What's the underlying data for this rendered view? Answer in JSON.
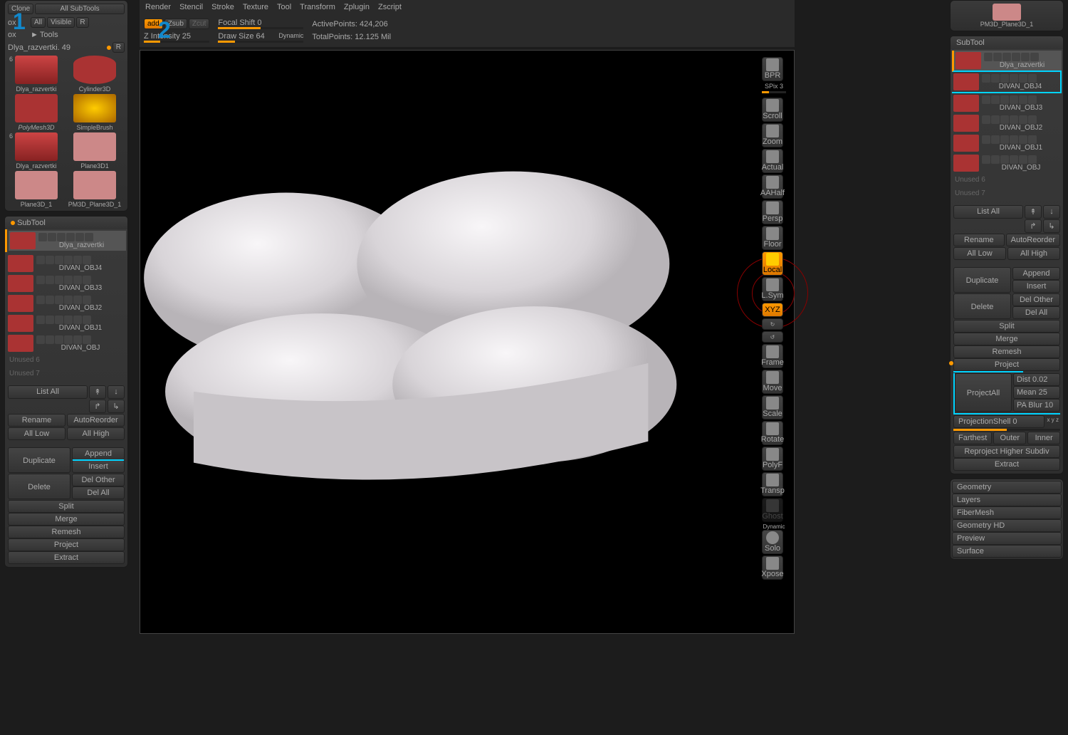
{
  "left": {
    "clone": "Clone",
    "makePoly": "All SubTools",
    "boxAll": "All",
    "visible": "Visible",
    "r": "R",
    "tools": "Tools",
    "toolName": "Dlya_razvertki. 49",
    "items": [
      {
        "label": "Dlya_razvertki",
        "count": "6"
      },
      {
        "label": "Cylinder3D"
      },
      {
        "label": "PolyMesh3D"
      },
      {
        "label": "SimpleBrush"
      },
      {
        "label": "Dlya_razvertki",
        "count": "6"
      },
      {
        "label": "Plane3D1"
      },
      {
        "label": "Plane3D_1"
      },
      {
        "label": "PM3D_Plane3D_1"
      }
    ]
  },
  "subtool": {
    "header": "SubTool",
    "items": [
      {
        "name": "Dlya_razvertki",
        "active": true
      },
      {
        "name": "DIVAN_OBJ4"
      },
      {
        "name": "DIVAN_OBJ3"
      },
      {
        "name": "DIVAN_OBJ2"
      },
      {
        "name": "DIVAN_OBJ1"
      },
      {
        "name": "DIVAN_OBJ"
      }
    ],
    "unused6": "Unused  6",
    "unused7": "Unused  7",
    "listAll": "List All",
    "rename": "Rename",
    "autoReorder": "AutoReorder",
    "allLow": "All Low",
    "allHigh": "All High",
    "duplicate": "Duplicate",
    "append": "Append",
    "insert": "Insert",
    "delete": "Delete",
    "delOther": "Del Other",
    "delAll": "Del All",
    "split": "Split",
    "merge": "Merge",
    "remesh": "Remesh",
    "project": "Project",
    "extract": "Extract",
    "projectAll": "ProjectAll",
    "dist": "Dist 0.02",
    "mean": "Mean 25",
    "paBlur": "PA Blur 10",
    "projectionShell": "ProjectionShell 0",
    "xyz": "x y z",
    "farthest": "Farthest",
    "outer": "Outer",
    "inner": "Inner",
    "reproject": "Reproject Higher Subdiv"
  },
  "menu": {
    "items": [
      "Render",
      "Stencil",
      "Stroke",
      "Texture",
      "Tool",
      "Transform",
      "Zplugin",
      "Zscript"
    ]
  },
  "topbar": {
    "zadd": "add",
    "zsub": "Zsub",
    "zcut": "Zcut",
    "zIntensity": "Z Intensity 25",
    "focalShift": "Focal Shift 0",
    "drawSize": "Draw Size 64",
    "dynamic": "Dynamic",
    "activePoints": "ActivePoints: 424,206",
    "totalPoints": "TotalPoints: 12.125 Mil"
  },
  "rightbar": {
    "bpr": "BPR",
    "spix": "SPix 3",
    "scroll": "Scroll",
    "zoom": "Zoom",
    "actual": "Actual",
    "aahalf": "AAHalf",
    "persp": "Persp",
    "floor": "Floor",
    "local": "Local",
    "lsym": "L.Sym",
    "xyz": "XYZ",
    "frame": "Frame",
    "move": "Move",
    "scale": "Scale",
    "rotate": "Rotate",
    "polyf": "PolyF",
    "transp": "Transp",
    "ghost": "Ghost",
    "dynamic": "Dynamic",
    "solo": "Solo",
    "xpose": "Xpose"
  },
  "topright": {
    "label": "PM3D_Plane3D_1"
  },
  "rightSections": [
    "Geometry",
    "Layers",
    "FiberMesh",
    "Geometry HD",
    "Preview",
    "Surface"
  ],
  "annotations": {
    "one": "1",
    "two": "2"
  }
}
